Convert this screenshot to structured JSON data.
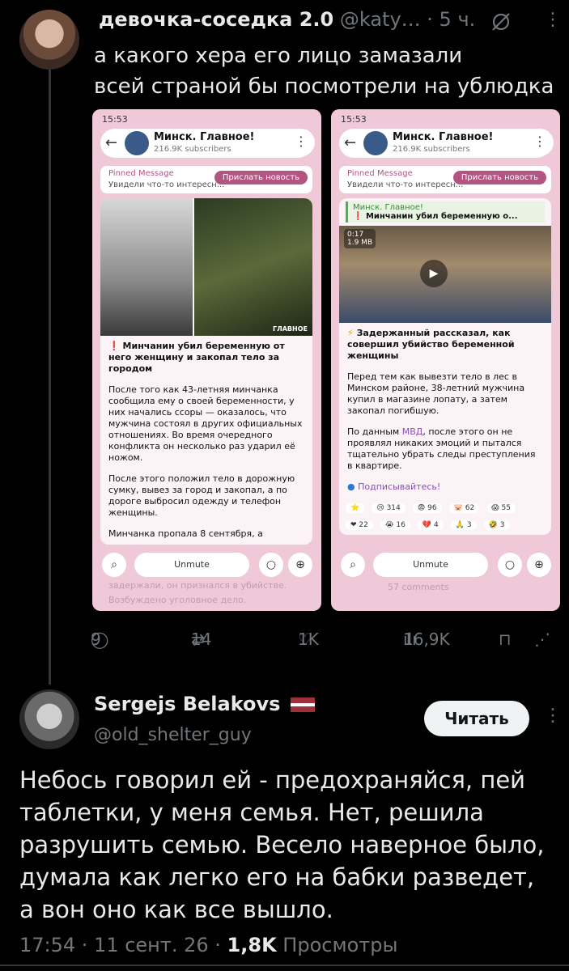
{
  "tweet1": {
    "author_name": "девочка-соседка 2.0",
    "author_handle": "@katy…",
    "time": "· 5 ч.",
    "text_line1": "а какого хера его лицо замазали",
    "text_line2": "всей страной бы посмотрели на ублюдка",
    "actions": {
      "replies": "9",
      "reposts": "14",
      "likes": "1K",
      "views": "16,9K"
    }
  },
  "shot_common": {
    "time": "15:53",
    "channel_name": "Минск. Главное!",
    "channel_subs": "216.9K subscribers",
    "pinned_label": "Pinned Message",
    "pinned_text": "Увидели что-то интересн...",
    "pinned_button": "Прислать новость",
    "unmute": "Unmute"
  },
  "shot1": {
    "photo_caption": "ГЛАВНОЕ",
    "headline": "Минчанин убил беременную от него женщину и закопал тело за городом",
    "para1": "После того как 43-летняя минчанка сообщила ему о своей беременности, у них начались ссоры — оказалось, что мужчина состоял в других официальных отношениях. Во время очередного конфликта он несколько раз ударил её ножом.",
    "para2": "После этого положил тело в дорожную сумку, вывез за город и закопал, а по дороге выбросил одежду и телефон женщины.",
    "para3": "Минчанка пропала 8 сентября, а",
    "bottom1": "задержали, он признался в убийстве.",
    "bottom2": "Возбуждено уголовное дело."
  },
  "shot2": {
    "reply_channel": "Минск. Главное!",
    "reply_text": "Минчанин убил беременную о...",
    "video_time": "0:17",
    "video_size": "1.9 MB",
    "headline": "Задержанный рассказал, как совершил убийство беременной женщины",
    "para1": "Перед тем как вывезти тело в лес в Минском районе, 38-летний мужчина купил в магазине лопату, а затем закопал погибшую.",
    "para2_a": "По данным ",
    "para2_link": "МВД",
    "para2_b": ", после этого он не проявлял никаких эмоций и пытался тщательно убрать следы преступления в квартире.",
    "subscribe": "Подписывайтесь!",
    "reactions": [
      "314",
      "96",
      "62",
      "55",
      "22",
      "16",
      "4",
      "3",
      "3"
    ],
    "comments": "57 comments"
  },
  "tweet2": {
    "author_name": "Sergejs Belakovs",
    "author_handle": "@old_shelter_guy",
    "follow_label": "Читать",
    "text": "Небось говорил ей - предохраняйся, пей таблетки, у меня семья. Нет, решила разрушить семью. Весело наверное было, думала как легко его на бабки разведет, а вон оно как все вышло.",
    "time": "17:54 · 11 сент. 26 · ",
    "views": "1,8K",
    "views_label": " Просмотры"
  }
}
